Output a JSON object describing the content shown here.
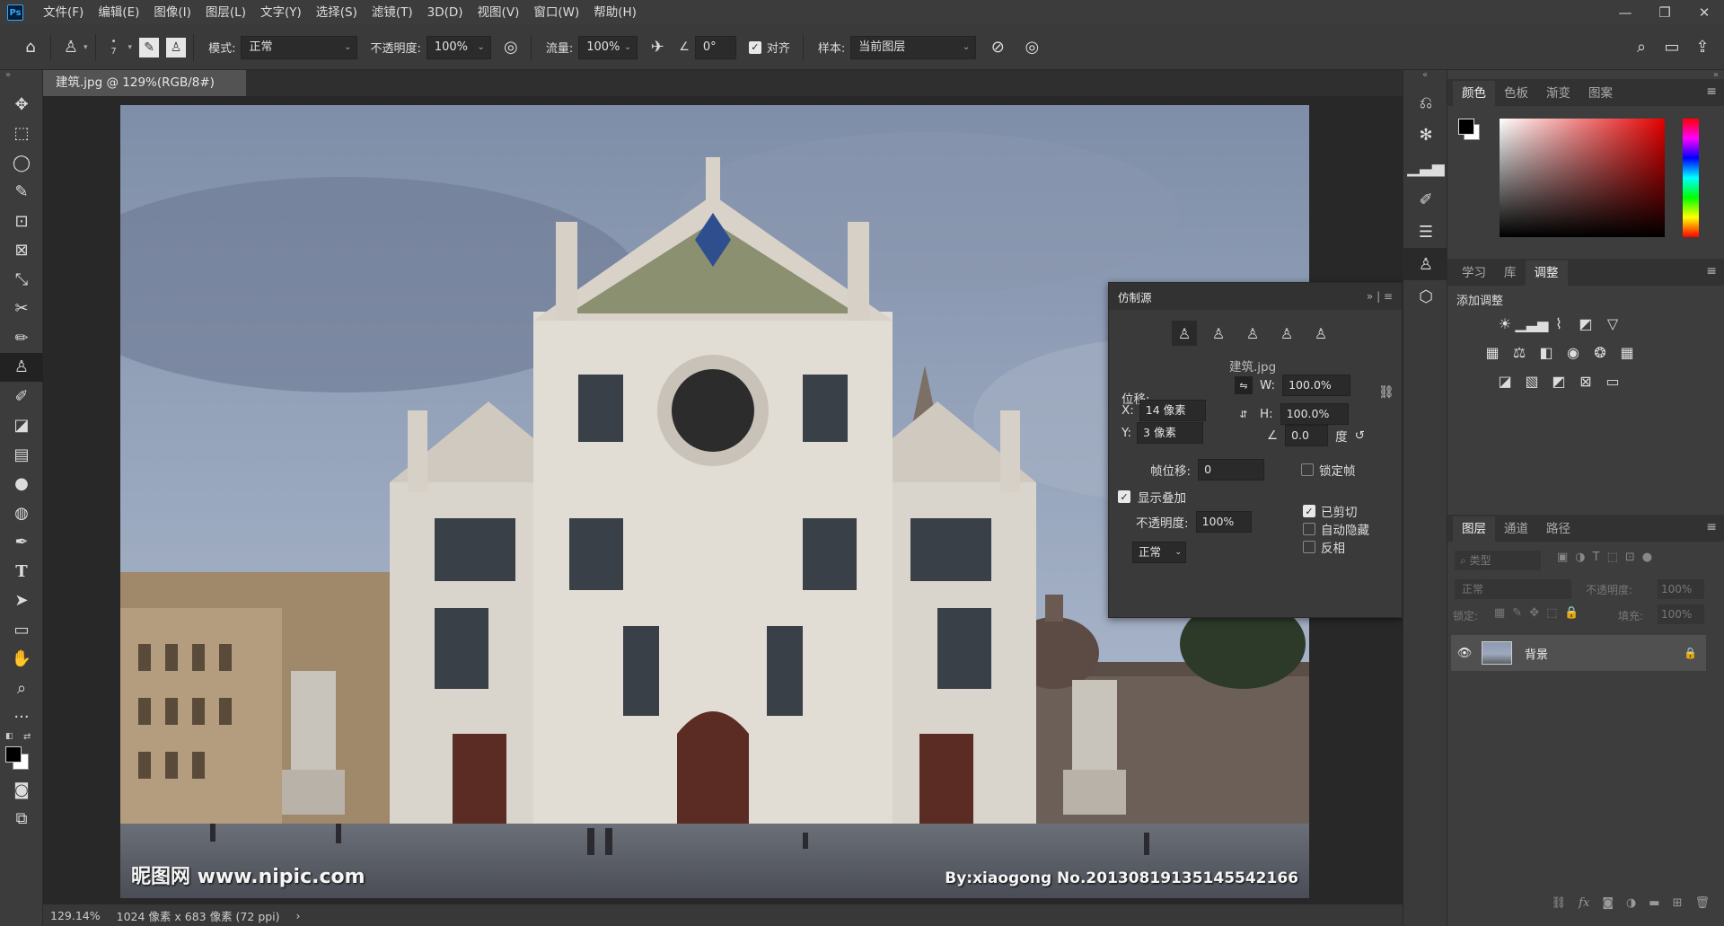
{
  "app": {
    "logo": "Ps"
  },
  "menu": [
    "文件(F)",
    "编辑(E)",
    "图像(I)",
    "图层(L)",
    "文字(Y)",
    "选择(S)",
    "滤镜(T)",
    "3D(D)",
    "视图(V)",
    "窗口(W)",
    "帮助(H)"
  ],
  "window_controls": {
    "minimize": "—",
    "restore": "❐",
    "close": "✕"
  },
  "options": {
    "brush_size": "7",
    "mode_label": "模式:",
    "mode_value": "正常",
    "opacity_label": "不透明度:",
    "opacity_value": "100%",
    "flow_label": "流量:",
    "flow_value": "100%",
    "angle_value": "0°",
    "align_label": "对齐",
    "sample_label": "样本:",
    "sample_value": "当前图层"
  },
  "document": {
    "tab_title": "建筑.jpg @ 129%(RGB/8#) *",
    "close": "×",
    "watermark_left": "昵图网 www.nipic.com",
    "watermark_right": "By:xiaogong  No.20130819135145542166"
  },
  "status": {
    "zoom": "129.14%",
    "dimensions": "1024 像素 x 683 像素 (72 ppi)",
    "arrow": "›"
  },
  "clone_source": {
    "title": "仿制源",
    "source_file": "建筑.jpg",
    "offset_label": "位移:",
    "x_label": "X:",
    "x_value": "14 像素",
    "y_label": "Y:",
    "y_value": "3 像素",
    "w_label": "W:",
    "w_value": "100.0%",
    "h_label": "H:",
    "h_value": "100.0%",
    "angle_value": "0.0",
    "degree_label": "度",
    "frame_offset_label": "帧位移:",
    "frame_offset_value": "0",
    "lock_frame_label": "锁定帧",
    "show_overlay_label": "显示叠加",
    "opacity_label": "不透明度:",
    "opacity_value": "100%",
    "blend_value": "正常",
    "clipped_label": "已剪切",
    "auto_hide_label": "自动隐藏",
    "invert_label": "反相"
  },
  "color_panel": {
    "tabs": [
      "颜色",
      "色板",
      "渐变",
      "图案"
    ],
    "foreground": "#000000",
    "background": "#ffffff"
  },
  "adjust_panel": {
    "tabs": [
      "学习",
      "库",
      "调整"
    ],
    "heading": "添加调整"
  },
  "layers_panel": {
    "tabs": [
      "图层",
      "通道",
      "路径"
    ],
    "filter_placeholder": "类型",
    "blend": "正常",
    "opacity_label": "不透明度:",
    "opacity_value": "100%",
    "lock_label": "锁定:",
    "fill_label": "填充:",
    "fill_value": "100%",
    "layers": [
      {
        "name": "背景"
      }
    ]
  },
  "colors": {
    "accent": "#31a8ff",
    "panel_bg": "#3d3d3d",
    "canvas_bg": "#282828"
  }
}
